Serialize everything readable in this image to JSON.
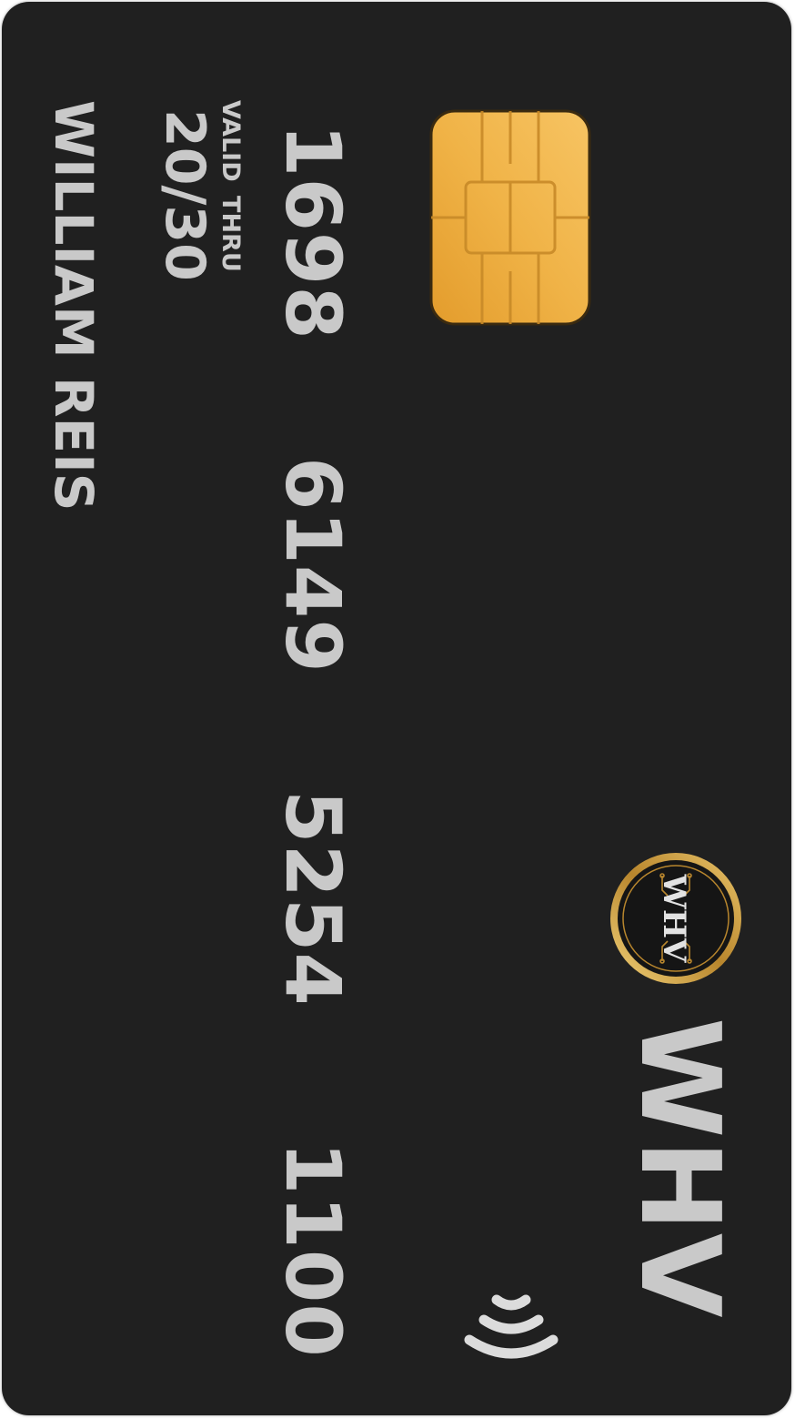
{
  "card": {
    "number_groups": [
      "1698",
      "6149",
      "5254",
      "1100"
    ],
    "valid_label": "VALID THRU",
    "valid_date": "20/30",
    "holder_name": "WILLIAM REIS",
    "brand_name": "WHV",
    "logo_monogram": "WHV",
    "icons": {
      "chip": "emv-chip-icon",
      "contactless": "contactless-icon",
      "logo": "whv-seal-logo"
    }
  },
  "colors": {
    "card_background": "#202020",
    "text": "#c9c9c9",
    "chip_gold": "#f0b347",
    "logo_gold": "#c89a3a"
  }
}
